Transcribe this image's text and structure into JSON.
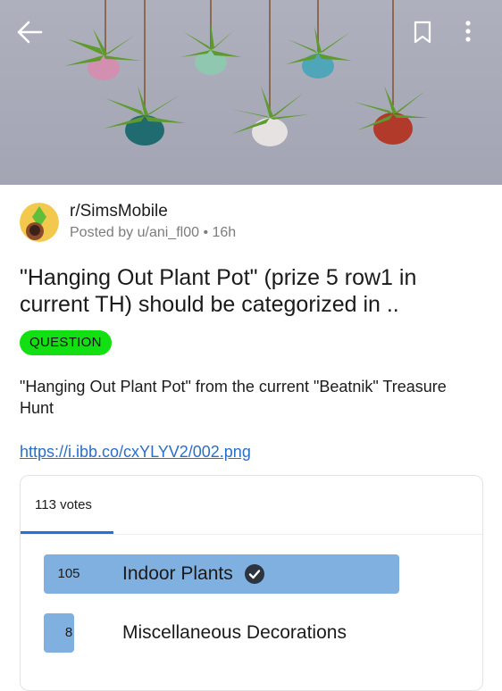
{
  "header": {
    "back_icon": "arrow-left-icon",
    "bookmark_icon": "bookmark-icon",
    "more_icon": "more-vertical-icon"
  },
  "post": {
    "subreddit": "r/SimsMobile",
    "meta": "Posted by u/ani_fl00 • 16h",
    "title": "\"Hanging Out Plant Pot\" (prize 5 row1 in current TH) should be categorized in ..",
    "flair": "QUESTION",
    "body": "\"Hanging Out Plant Pot\" from the current \"Beatnik\" Treasure Hunt",
    "link": "https://i.ibb.co/cxYLYV2/002.png"
  },
  "poll": {
    "votes_label": "113 votes",
    "options": [
      {
        "count": "105",
        "label": "Indoor Plants",
        "fraction": 0.929,
        "selected": true
      },
      {
        "count": "8",
        "label": "Miscellaneous Decorations",
        "fraction": 0.071,
        "selected": false
      }
    ]
  },
  "colors": {
    "flair_bg": "#13e013",
    "poll_bar": "#7fb0e0",
    "accent": "#1e73d6",
    "link": "#2a6fc9"
  }
}
